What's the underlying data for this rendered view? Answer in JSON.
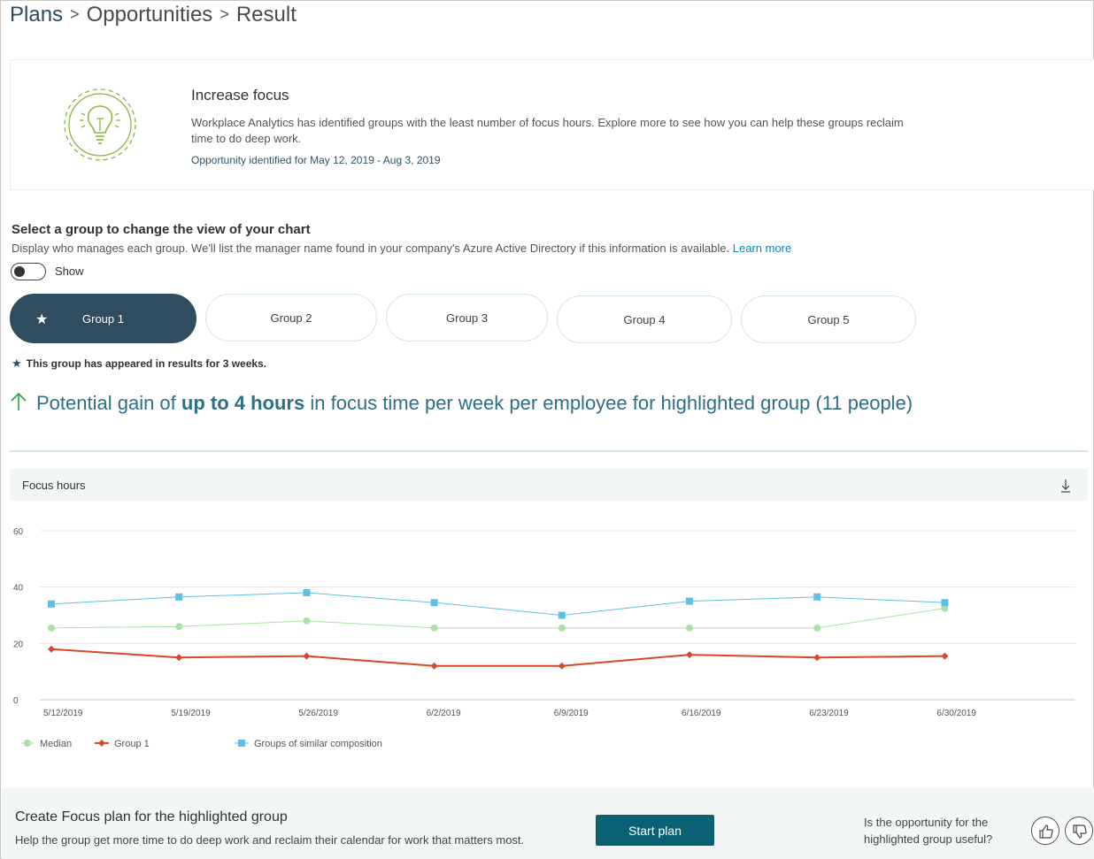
{
  "breadcrumb": {
    "root": "Plans",
    "middle": "Opportunities",
    "current": "Result",
    "separator": ">"
  },
  "opportunity": {
    "icon": "lightbulb-icon",
    "title": "Increase focus",
    "description": "Workplace Analytics has identified groups with the least number of focus hours. Explore more to see how you can help these groups reclaim time to do deep work.",
    "date_range": "Opportunity identified for May 12, 2019 - Aug 3, 2019"
  },
  "group_select": {
    "title": "Select a group to change the view of your chart",
    "description": "Display who manages each group. We'll list the manager name found in your company's Azure Active Directory if this information is available.",
    "learn_more": "Learn more",
    "toggle_label": "Show",
    "toggle_on": false,
    "groups": [
      "Group 1",
      "Group 2",
      "Group 3",
      "Group 4",
      "Group 5"
    ],
    "selected": "Group 1",
    "note": "This group has appeared in results for 3 weeks."
  },
  "gain": {
    "prefix": "Potential gain of",
    "highlight": "up to 4 hours",
    "suffix": "in focus time per week per employee for highlighted group (11 people)",
    "color": "#2e6f86",
    "arrow_color": "#2ea043"
  },
  "chart_header": {
    "title": "Focus hours",
    "download_icon": "download-icon"
  },
  "chart_data": {
    "type": "line",
    "x": [
      "5/12/2019",
      "5/19/2019",
      "5/26/2019",
      "6/2/2019",
      "6/9/2019",
      "6/16/2019",
      "6/23/2019",
      "6/30/2019"
    ],
    "ylim": [
      0,
      60
    ],
    "yticks": [
      0,
      20,
      40,
      60
    ],
    "grid": true,
    "legend_position": "bottom-left",
    "series": [
      {
        "name": "Median",
        "color": "#a6e3a6",
        "marker": "circle",
        "values": [
          25.5,
          26,
          28,
          25.5,
          25.5,
          25.5,
          25.5,
          32.5
        ]
      },
      {
        "name": "Group 1",
        "color": "#d9472b",
        "marker": "diamond",
        "values": [
          18,
          15,
          15.5,
          12,
          12,
          16,
          15,
          15.5
        ]
      },
      {
        "name": "Groups of similar composition",
        "color": "#5fbfe6",
        "marker": "square",
        "values": [
          34,
          36.5,
          38,
          34.5,
          30,
          35,
          36.5,
          34.5
        ]
      }
    ]
  },
  "footer": {
    "title": "Create Focus plan for the highlighted group",
    "description": "Help the group get more time to do deep work and reclaim their calendar for work that matters most.",
    "start_button": "Start plan",
    "useful_question": "Is the opportunity for the highlighted group useful?",
    "thumbs_up_icon": "thumbs-up-icon",
    "thumbs_down_icon": "thumbs-down-icon"
  }
}
